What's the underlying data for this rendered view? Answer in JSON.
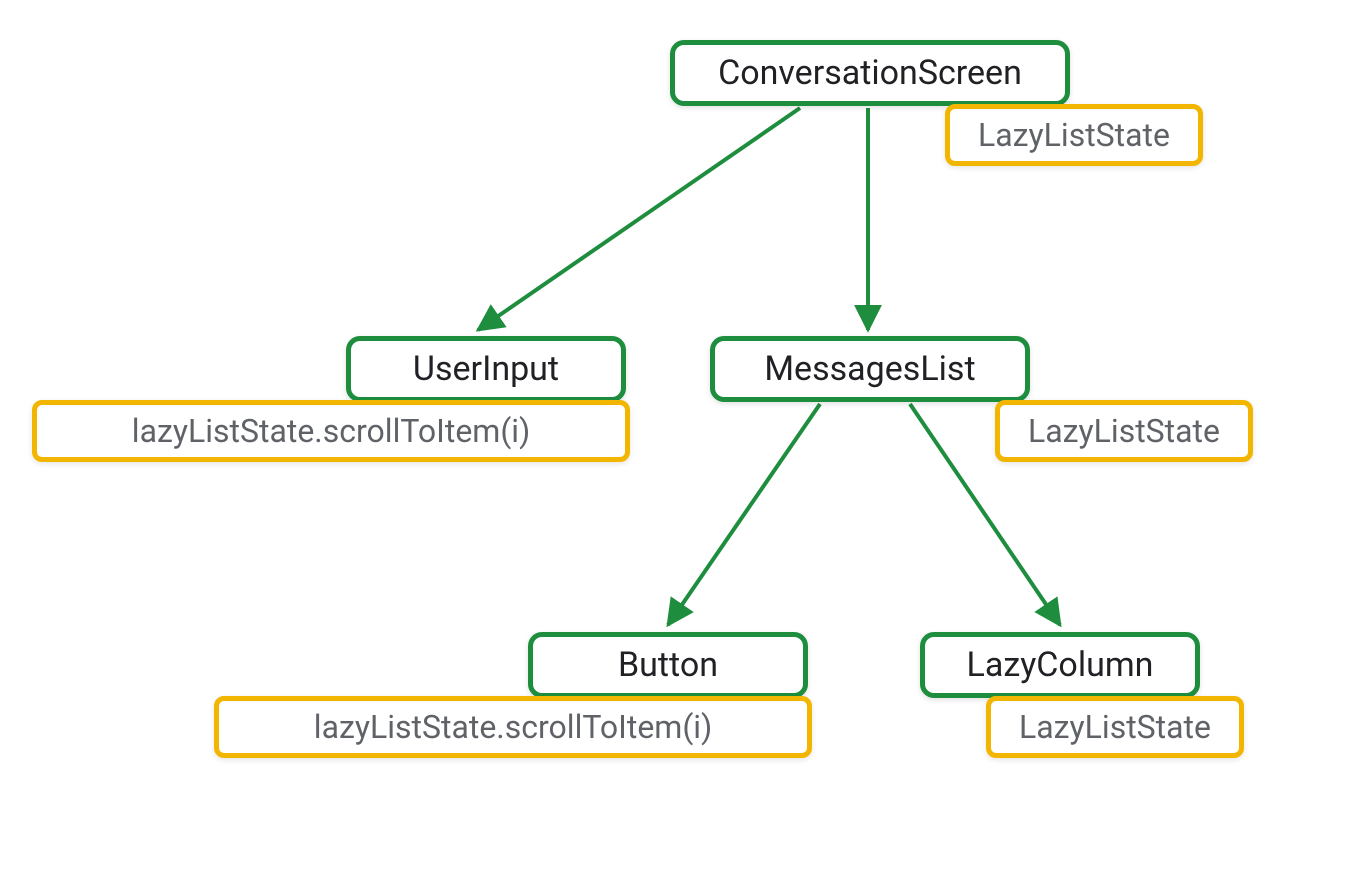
{
  "nodes": {
    "conversationScreen": {
      "label": "ConversationScreen"
    },
    "userInput": {
      "label": "UserInput"
    },
    "messagesList": {
      "label": "MessagesList"
    },
    "button": {
      "label": "Button"
    },
    "lazyColumn": {
      "label": "LazyColumn"
    }
  },
  "annotations": {
    "convState": {
      "text": "LazyListState"
    },
    "userInputAction": {
      "text": "lazyListState.scrollToItem(i)"
    },
    "messagesState": {
      "text": "LazyListState"
    },
    "buttonAction": {
      "text": "lazyListState.scrollToItem(i)"
    },
    "lazyColumnState": {
      "text": "LazyListState"
    }
  },
  "colors": {
    "nodeBorder": "#1e8e3e",
    "annotBorder": "#f2b600",
    "edge": "#1e8e3e"
  },
  "tree": {
    "root": "conversationScreen",
    "children": {
      "conversationScreen": [
        "userInput",
        "messagesList"
      ],
      "messagesList": [
        "button",
        "lazyColumn"
      ]
    }
  }
}
